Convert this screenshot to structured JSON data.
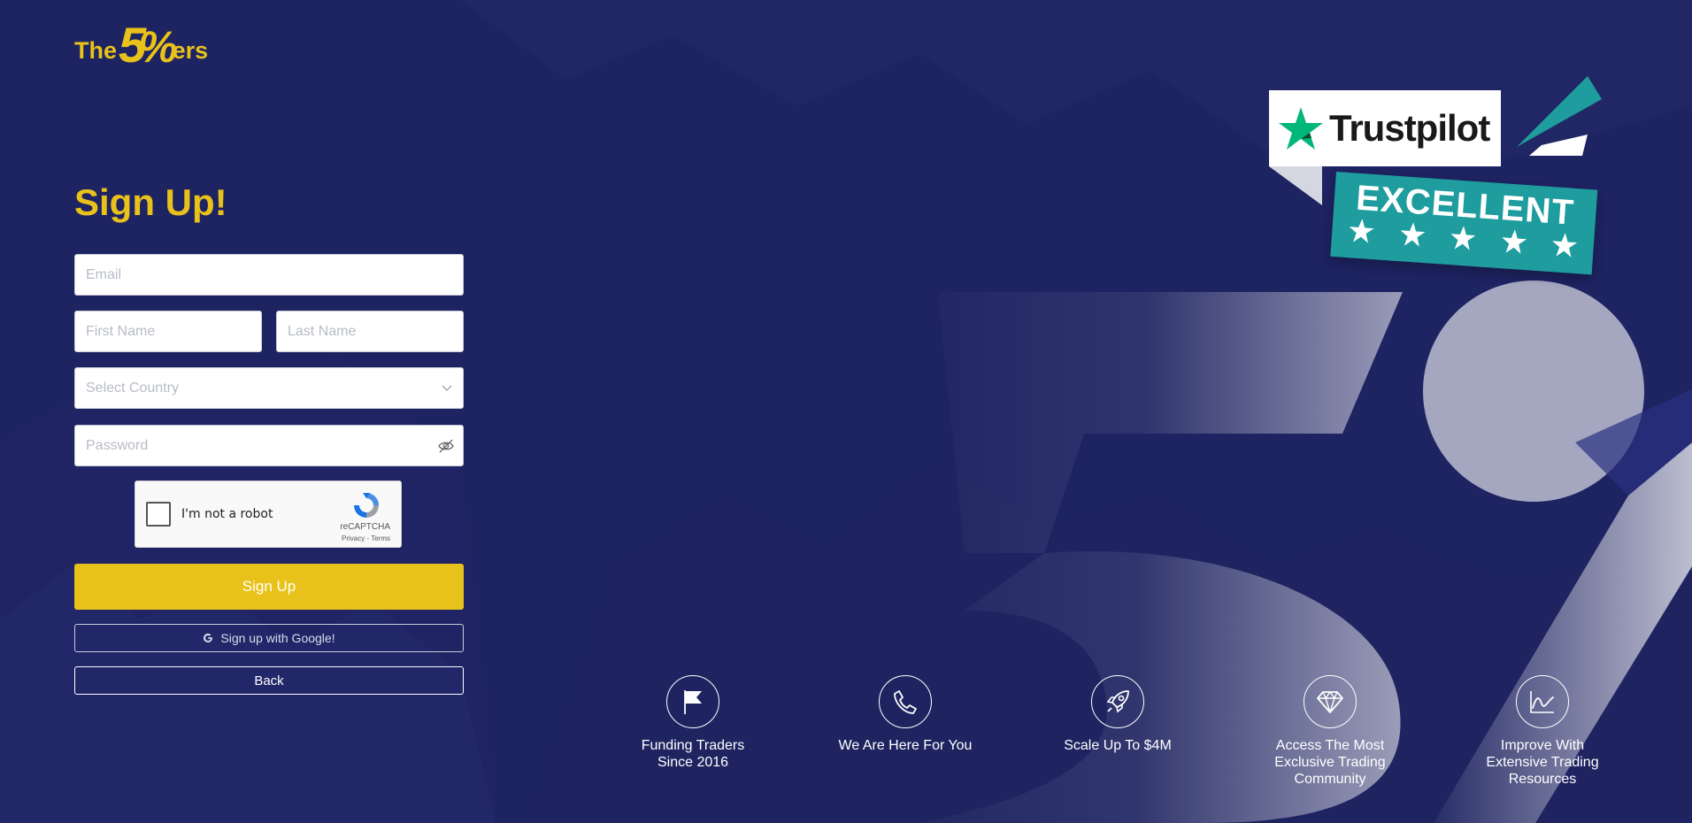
{
  "brand": {
    "logo_prefix": "The",
    "logo_number": "5",
    "logo_slash": "%",
    "logo_suffix": "ers",
    "accent_color": "#e8c21a",
    "background_color": "#1e2361"
  },
  "form": {
    "title": "Sign Up!",
    "email_placeholder": "Email",
    "first_name_placeholder": "First Name",
    "last_name_placeholder": "Last Name",
    "country_placeholder": "Select Country",
    "password_placeholder": "Password",
    "captcha_label": "I'm not a robot",
    "captcha_brand": "reCAPTCHA",
    "captcha_links": "Privacy - Terms",
    "signup_button": "Sign Up",
    "google_button": "Sign up with Google!",
    "back_button": "Back"
  },
  "trustpilot": {
    "name": "Trustpilot",
    "rating_text": "EXCELLENT",
    "stars": 5,
    "star_color": "#00b67a",
    "ribbon_color": "#1e9c9e"
  },
  "features": [
    {
      "icon": "flag-icon",
      "text": "Funding Traders Since 2016"
    },
    {
      "icon": "phone-icon",
      "text": "We Are Here For You"
    },
    {
      "icon": "rocket-icon",
      "text": "Scale Up To $4M"
    },
    {
      "icon": "diamond-icon",
      "text": "Access The Most Exclusive Trading Community"
    },
    {
      "icon": "chart-icon",
      "text": "Improve With Extensive Trading Resources"
    }
  ]
}
